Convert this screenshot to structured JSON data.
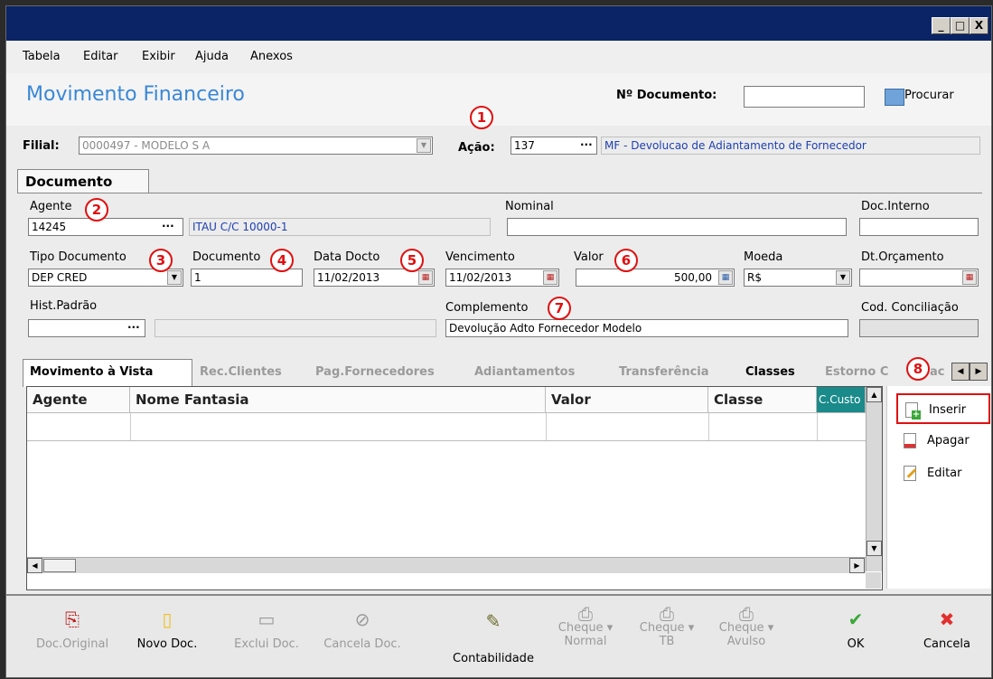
{
  "window": {
    "controls": [
      "_",
      "□",
      "X"
    ]
  },
  "menu": [
    {
      "label": "Tabela"
    },
    {
      "label": "Editar"
    },
    {
      "label": "Exibir"
    },
    {
      "label": "Ajuda"
    },
    {
      "label": "Anexos"
    }
  ],
  "header": {
    "title": "Movimento Financeiro",
    "doc_number_label": "Nº Documento:",
    "doc_number_value": "",
    "search_label": "Procurar"
  },
  "top_fields": {
    "filial_label": "Filial:",
    "filial_value": "0000497 - MODELO S A",
    "acao_label": "Ação:",
    "acao_value": "137",
    "acao_desc": "MF - Devolucao de Adiantamento de Fornecedor"
  },
  "doc_tab": "Documento",
  "form": {
    "agente_label": "Agente",
    "agente_value": "14245",
    "agente_desc": "ITAU C/C 10000-1",
    "nominal_label": "Nominal",
    "nominal_value": "",
    "doc_interno_label": "Doc.Interno",
    "doc_interno_value": "",
    "tipo_doc_label": "Tipo Documento",
    "tipo_doc_value": "DEP CRED",
    "documento_label": "Documento",
    "documento_value": "1",
    "data_docto_label": "Data Docto",
    "data_docto_value": "11/02/2013",
    "vencimento_label": "Vencimento",
    "vencimento_value": "11/02/2013",
    "valor_label": "Valor",
    "valor_value": "500,00",
    "moeda_label": "Moeda",
    "moeda_value": "R$",
    "dt_orcamento_label": "Dt.Orçamento",
    "dt_orcamento_value": "",
    "hist_padrao_label": "Hist.Padrão",
    "hist_padrao_value": "",
    "complemento_label": "Complemento",
    "complemento_value": "Devolução Adto Fornecedor Modelo",
    "cod_conciliacao_label": "Cod. Conciliação",
    "cod_conciliacao_value": ""
  },
  "badges": [
    "1",
    "2",
    "3",
    "4",
    "5",
    "6",
    "7",
    "8"
  ],
  "tabs": [
    {
      "label": "Movimento à Vista"
    },
    {
      "label": "Rec.Clientes"
    },
    {
      "label": "Pag.Fornecedores"
    },
    {
      "label": "Adiantamentos"
    },
    {
      "label": "Transferência"
    },
    {
      "label": "Classes"
    },
    {
      "label": "Estorno C"
    },
    {
      "label": "ac"
    }
  ],
  "grid": {
    "columns": [
      "Agente",
      "Nome Fantasia",
      "Valor",
      "Classe",
      "C.Custo"
    ]
  },
  "side_buttons": [
    "Inserir",
    "Apagar",
    "Editar"
  ],
  "toolbar": [
    {
      "label": "Doc.Original"
    },
    {
      "label": "Novo Doc."
    },
    {
      "label": "Exclui Doc."
    },
    {
      "label": "Cancela Doc."
    },
    {
      "label": "Contabilidade"
    },
    {
      "line1": "Cheque",
      "line2": "Normal"
    },
    {
      "line1": "Cheque",
      "line2": "TB"
    },
    {
      "line1": "Cheque",
      "line2": "Avulso"
    },
    {
      "label": "OK"
    },
    {
      "label": "Cancela"
    }
  ],
  "colors": {
    "title_blue": "#3a87d6",
    "titlebar": "#0a2466",
    "badge_red": "#e01010",
    "link_blue": "#1d3fb0"
  }
}
